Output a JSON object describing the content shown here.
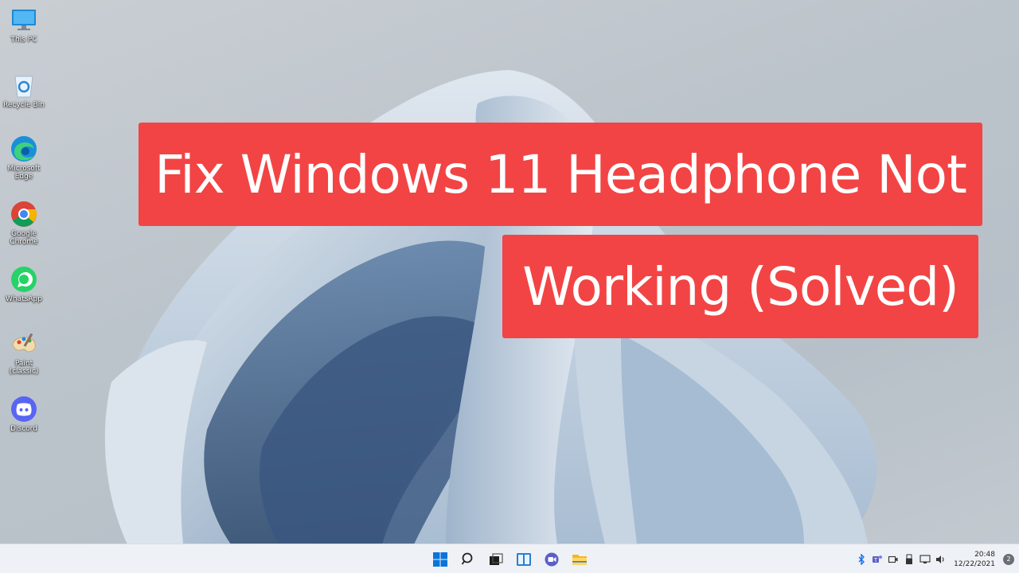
{
  "desktop": {
    "icons": [
      {
        "label": "This PC",
        "icon": "monitor-icon"
      },
      {
        "label": "Recycle Bin",
        "icon": "recycle-bin-icon"
      },
      {
        "label": "Microsoft Edge",
        "icon": "edge-icon"
      },
      {
        "label": "Google Chrome",
        "icon": "chrome-icon"
      },
      {
        "label": "WhatsApp",
        "icon": "whatsapp-icon"
      },
      {
        "label": "Paint (classic)",
        "icon": "paint-icon"
      },
      {
        "label": "Discord",
        "icon": "discord-icon"
      }
    ]
  },
  "banner": {
    "line1": "Fix Windows 11 Headphone Not",
    "line2": "Working (Solved)",
    "color": "#f24444"
  },
  "taskbar": {
    "apps": [
      "start-icon",
      "search-icon",
      "task-view-icon",
      "widgets-icon",
      "teams-chat-icon",
      "file-explorer-icon"
    ],
    "tray": [
      "bluetooth-icon",
      "teams-icon",
      "meet-now-icon",
      "usb-icon",
      "network-icon",
      "volume-icon"
    ],
    "time": "20:48",
    "date": "12/22/2021",
    "notification_count": "2"
  }
}
